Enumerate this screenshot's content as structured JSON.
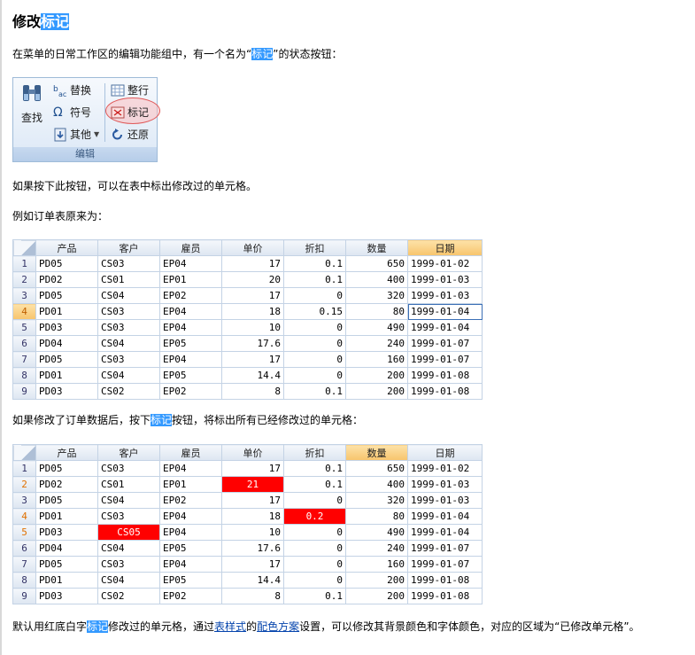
{
  "title": {
    "text": "修改",
    "highlight": "标记"
  },
  "para1": {
    "before": "在菜单的日常工作区的编辑功能组中，有一个名为“",
    "highlight": "标记",
    "after": "”的状态按钮："
  },
  "ribbon": {
    "find": "查找",
    "replace": "替换",
    "symbol": "符号",
    "other": "其他",
    "row": "整行",
    "mark": "标记",
    "restore": "还原",
    "group": "编辑",
    "accent": "#3399ff"
  },
  "para2": "如果按下此按钮，可以在表中标出修改过的单元格。",
  "para3": "例如订单表原来为：",
  "table_headers": [
    "产品",
    "客户",
    "雇员",
    "单价",
    "折扣",
    "数量",
    "日期"
  ],
  "table1": {
    "rows": [
      {
        "n": "1",
        "p": "PD05",
        "c": "CS03",
        "e": "EP04",
        "u": "17",
        "d": "0.1",
        "q": "650",
        "dt": "1999-01-02"
      },
      {
        "n": "2",
        "p": "PD02",
        "c": "CS01",
        "e": "EP01",
        "u": "20",
        "d": "0.1",
        "q": "400",
        "dt": "1999-01-03"
      },
      {
        "n": "3",
        "p": "PD05",
        "c": "CS04",
        "e": "EP02",
        "u": "17",
        "d": "0",
        "q": "320",
        "dt": "1999-01-03"
      },
      {
        "n": "4",
        "p": "PD01",
        "c": "CS03",
        "e": "EP04",
        "u": "18",
        "d": "0.15",
        "q": "80",
        "dt": "1999-01-04"
      },
      {
        "n": "5",
        "p": "PD03",
        "c": "CS03",
        "e": "EP04",
        "u": "10",
        "d": "0",
        "q": "490",
        "dt": "1999-01-04"
      },
      {
        "n": "6",
        "p": "PD04",
        "c": "CS04",
        "e": "EP05",
        "u": "17.6",
        "d": "0",
        "q": "240",
        "dt": "1999-01-07"
      },
      {
        "n": "7",
        "p": "PD05",
        "c": "CS03",
        "e": "EP04",
        "u": "17",
        "d": "0",
        "q": "160",
        "dt": "1999-01-07"
      },
      {
        "n": "8",
        "p": "PD01",
        "c": "CS04",
        "e": "EP05",
        "u": "14.4",
        "d": "0",
        "q": "200",
        "dt": "1999-01-08"
      },
      {
        "n": "9",
        "p": "PD03",
        "c": "CS02",
        "e": "EP02",
        "u": "8",
        "d": "0.1",
        "q": "200",
        "dt": "1999-01-08"
      }
    ]
  },
  "para4": {
    "before": "如果修改了订单数据后，按下",
    "highlight": "标记",
    "after": "按钮，将标出所有已经修改过的单元格："
  },
  "table2": {
    "rows": [
      {
        "n": "1",
        "p": "PD05",
        "c": "CS03",
        "e": "EP04",
        "u": "17",
        "d": "0.1",
        "q": "650",
        "dt": "1999-01-02"
      },
      {
        "n": "2",
        "p": "PD02",
        "c": "CS01",
        "e": "EP01",
        "u": "21",
        "d": "0.1",
        "q": "400",
        "dt": "1999-01-03"
      },
      {
        "n": "3",
        "p": "PD05",
        "c": "CS04",
        "e": "EP02",
        "u": "17",
        "d": "0",
        "q": "320",
        "dt": "1999-01-03"
      },
      {
        "n": "4",
        "p": "PD01",
        "c": "CS03",
        "e": "EP04",
        "u": "18",
        "d": "0.2",
        "q": "80",
        "dt": "1999-01-04"
      },
      {
        "n": "5",
        "p": "PD03",
        "c": "CS05",
        "e": "EP04",
        "u": "10",
        "d": "0",
        "q": "490",
        "dt": "1999-01-04"
      },
      {
        "n": "6",
        "p": "PD04",
        "c": "CS04",
        "e": "EP05",
        "u": "17.6",
        "d": "0",
        "q": "240",
        "dt": "1999-01-07"
      },
      {
        "n": "7",
        "p": "PD05",
        "c": "CS03",
        "e": "EP04",
        "u": "17",
        "d": "0",
        "q": "160",
        "dt": "1999-01-07"
      },
      {
        "n": "8",
        "p": "PD01",
        "c": "CS04",
        "e": "EP05",
        "u": "14.4",
        "d": "0",
        "q": "200",
        "dt": "1999-01-08"
      },
      {
        "n": "9",
        "p": "PD03",
        "c": "CS02",
        "e": "EP02",
        "u": "8",
        "d": "0.1",
        "q": "200",
        "dt": "1999-01-08"
      }
    ],
    "modified_color": "#ff0000"
  },
  "para5": {
    "t1": "默认用红底白字",
    "highlight": "标记",
    "t2": "修改过的单元格，通过",
    "link1": "表样式",
    "t3": "的",
    "link2": "配色方案",
    "t4": "设置，可以修改其背景颜色和字体颜色，对应的区域为“已修改单元格”。"
  }
}
